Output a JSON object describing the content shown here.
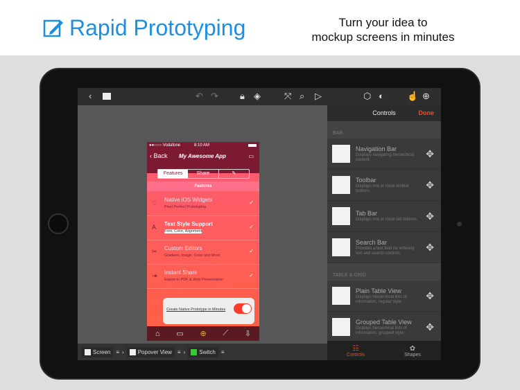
{
  "header": {
    "title": "Rapid Prototyping",
    "tagline_1": "Turn your idea to",
    "tagline_2": "mockup screens in minutes",
    "brand_color": "#1e8fe0"
  },
  "toolbar": {
    "icons": [
      "back-icon",
      "page-icon",
      "undo-icon",
      "redo-icon",
      "lock-icon",
      "layers-icon",
      "fullscreen-icon",
      "search-icon",
      "play-icon",
      "box-icon",
      "toggle-icon",
      "hand-icon",
      "add-icon"
    ]
  },
  "phone": {
    "carrier": "●●○○○ Vodafone",
    "time": "8:10 AM",
    "back": "Back",
    "title": "My Awesome App",
    "segments": [
      "Features",
      "Share"
    ],
    "section": "Features",
    "rows": [
      {
        "title": "Native iOS Widgets",
        "subtitle": "Pixel Perfect Prototyping"
      },
      {
        "title": "Text Style Support",
        "subtitle": "Font, Color, Alignment"
      },
      {
        "title": "Custom Editors",
        "subtitle": "Gradient, Image, Color and More"
      },
      {
        "title": "Instant Share",
        "subtitle": "Export to PDF & Web Presentation"
      }
    ],
    "popover": "Create Native Prototype in Minutes",
    "switch_on": true
  },
  "breadcrumb": [
    "Screen",
    "Popover View",
    "Switch"
  ],
  "panel": {
    "title": "Controls",
    "done": "Done",
    "accent": "#e6502e",
    "sections": [
      {
        "label": "BAR",
        "items": [
          {
            "title": "Navigation Bar",
            "desc": "Displays navigating hierarchical content."
          },
          {
            "title": "Toolbar",
            "desc": "Displays one or more toolbar buttons."
          },
          {
            "title": "Tab Bar",
            "desc": "Displays one or more tab buttons."
          },
          {
            "title": "Search Bar",
            "desc": "Provides a text field for entering text and search controls."
          }
        ]
      },
      {
        "label": "TABLE & GRID",
        "items": [
          {
            "title": "Plain Table View",
            "desc": "Displays hierarchical lists of information, regular style."
          },
          {
            "title": "Grouped Table View",
            "desc": "Displays hierarchical lists of information, grouped style."
          }
        ]
      }
    ],
    "tabs": [
      "Controls",
      "Shapes"
    ]
  }
}
